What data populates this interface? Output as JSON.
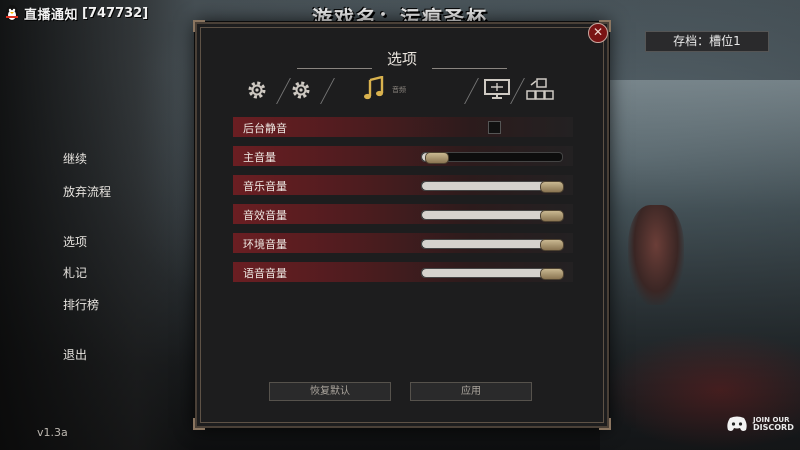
{
  "stream": {
    "text": "直播通知",
    "id": "[747732]"
  },
  "game_title": "游戏名：污痕圣杯",
  "save_slot": "存档：槽位1",
  "side_menu": [
    {
      "label": "继续"
    },
    {
      "label": "放弃流程"
    },
    {
      "label": "选项"
    },
    {
      "label": "札记"
    },
    {
      "label": "排行榜"
    },
    {
      "label": "退出"
    }
  ],
  "version": "v1.3a",
  "dialog": {
    "title": "选项",
    "tabs": [
      {
        "icon": "gear-icon"
      },
      {
        "icon": "gear-icon"
      },
      {
        "icon": "music-note-icon",
        "label": "音频",
        "active": true
      },
      {
        "icon": "monitor-icon"
      },
      {
        "icon": "controller-icon"
      }
    ],
    "settings": [
      {
        "label": "后台静音",
        "type": "checkbox",
        "checked": false
      },
      {
        "label": "主音量",
        "type": "slider",
        "value": 0.1
      },
      {
        "label": "音乐音量",
        "type": "slider",
        "value": 1.0
      },
      {
        "label": "音效音量",
        "type": "slider",
        "value": 1.0
      },
      {
        "label": "环境音量",
        "type": "slider",
        "value": 1.0
      },
      {
        "label": "语音音量",
        "type": "slider",
        "value": 1.0
      }
    ],
    "reset_label": "恢复默认",
    "apply_label": "应用",
    "close_symbol": "✕"
  },
  "discord": {
    "line1": "JOIN OUR",
    "line2": "DISCORD"
  },
  "colors": {
    "accent_red": "#6a1e22",
    "knob_gold": "#c9b891",
    "close_red": "#7a1414"
  }
}
